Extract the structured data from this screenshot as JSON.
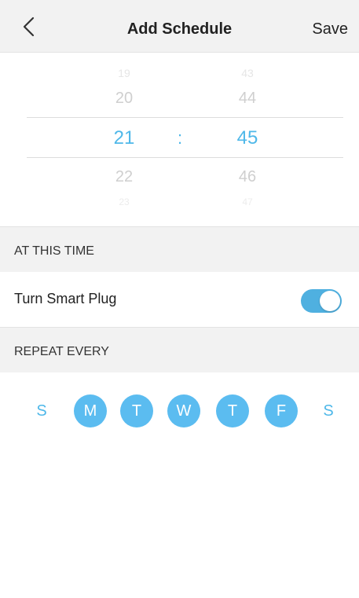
{
  "header": {
    "title": "Add Schedule",
    "save_label": "Save",
    "back_icon": "chevron-left-icon"
  },
  "time_picker": {
    "hours": {
      "far_above": "19",
      "above": "20",
      "selected": "21",
      "below": "22",
      "far_below": "23"
    },
    "separator": ":",
    "minutes": {
      "far_above": "43",
      "above": "44",
      "selected": "45",
      "below": "46",
      "far_below": "47"
    },
    "accent_color": "#4fb8e9"
  },
  "at_this_time": {
    "section_label": "AT THIS TIME",
    "row_label": "Turn Smart Plug",
    "toggle_on": true
  },
  "repeat": {
    "section_label": "REPEAT EVERY",
    "days": [
      {
        "label": "S",
        "selected": false
      },
      {
        "label": "M",
        "selected": true
      },
      {
        "label": "T",
        "selected": true
      },
      {
        "label": "W",
        "selected": true
      },
      {
        "label": "T",
        "selected": true
      },
      {
        "label": "F",
        "selected": true
      },
      {
        "label": "S",
        "selected": false
      }
    ]
  }
}
